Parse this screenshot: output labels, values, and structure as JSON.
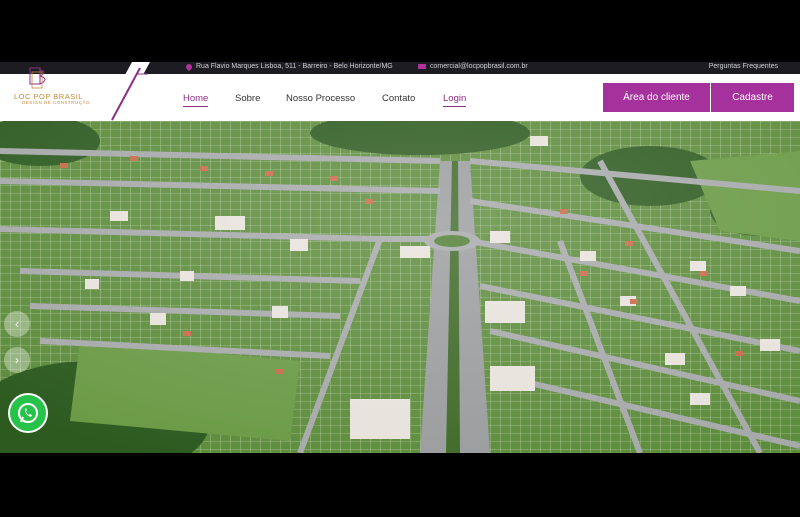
{
  "topbar": {
    "address": "Rua Flavio Marques Lisboa, 511 - Barreiro - Belo Horizonte/MG",
    "email": "comercial@locpopbrasil.com.br",
    "faq": "Perguntas Frequentes"
  },
  "brand": {
    "monogram": "LPB",
    "name": "LOC POP BRASIL",
    "tagline": "DESIGN DE CONSTRUÇÃO",
    "color": "#c48a3a"
  },
  "nav": {
    "home": "Home",
    "sobre": "Sobre",
    "processo": "Nosso Processo",
    "contato": "Contato",
    "login": "Login"
  },
  "actions": {
    "area_cliente": "Área do cliente",
    "cadastre": "Cadastre"
  },
  "colors": {
    "accent": "#a5329c",
    "nav_active": "#8b2f86",
    "topbar": "#1c1c22",
    "whatsapp": "#27c24a"
  },
  "icons": {
    "address": "map-pin-icon",
    "email": "envelope-icon",
    "prev": "chevron-left-icon",
    "next": "chevron-right-icon",
    "whatsapp": "whatsapp-icon"
  }
}
